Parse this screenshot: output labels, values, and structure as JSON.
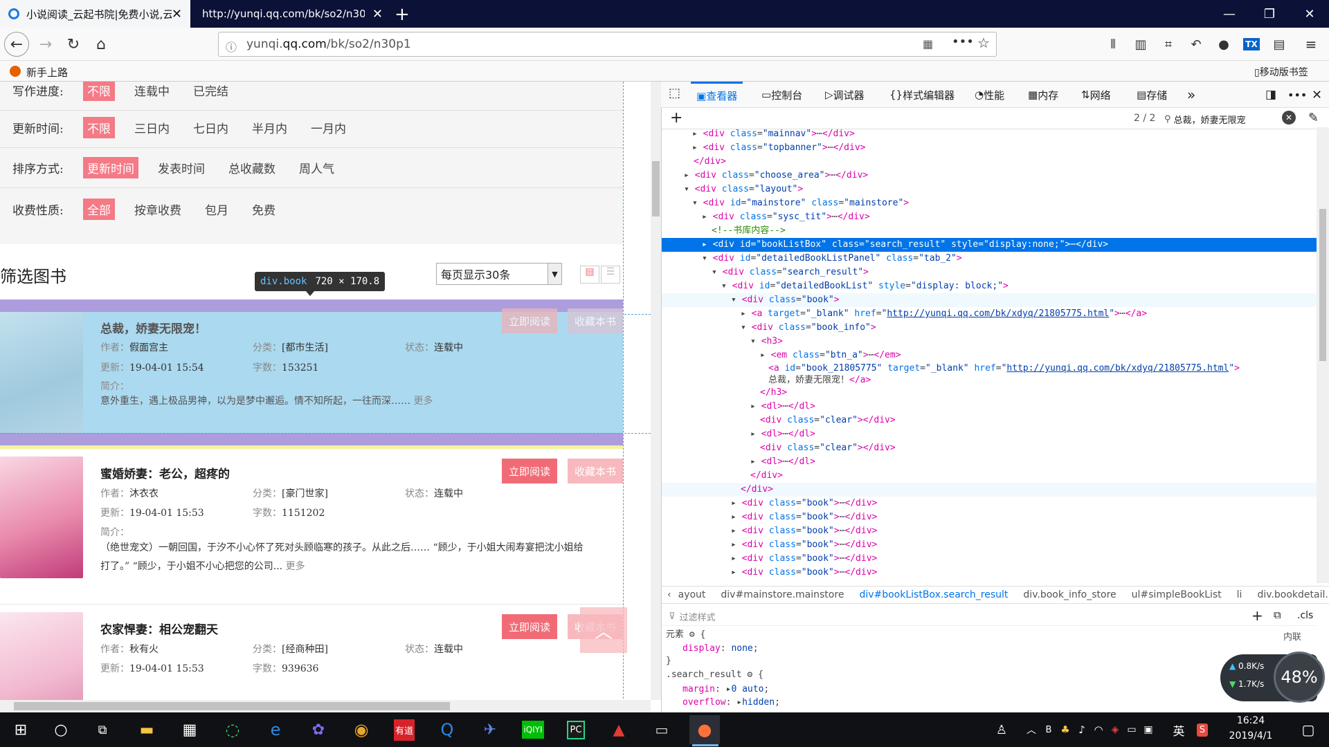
{
  "browser": {
    "tabs": [
      {
        "title": "小说阅读_云起书院|免费小说,云"
      },
      {
        "title": "http://yunqi.qq.com/bk/so2/n30"
      }
    ],
    "url_prefix": "yunqi.",
    "url_domain": "qq.com",
    "url_path": "/bk/so2/n30p1",
    "bookmark": "新手上路",
    "mobile_bookmark": "移动版书签"
  },
  "page": {
    "filters": [
      {
        "label": "写作进度:",
        "options": [
          "不限",
          "连载中",
          "已完结"
        ],
        "selected": 0
      },
      {
        "label": "更新时间:",
        "options": [
          "不限",
          "三日内",
          "七日内",
          "半月内",
          "一月内"
        ],
        "selected": 0
      },
      {
        "label": "排序方式:",
        "options": [
          "更新时间",
          "发表时间",
          "总收藏数",
          "周人气"
        ],
        "selected": 0
      },
      {
        "label": "收费性质:",
        "options": [
          "全部",
          "按章收费",
          "包月",
          "免费"
        ],
        "selected": 0
      }
    ],
    "section_title": "筛选图书",
    "per_page": "每页显示30条",
    "tooltip_tag": "div.book",
    "tooltip_size": "720 × 170.8",
    "read_label": "立即阅读",
    "fav_label": "收藏本书",
    "more_label": "更多",
    "intro_label": "简介：",
    "books": [
      {
        "title": "总裁，娇妻无限宠！",
        "author_label": "作者：",
        "author": "假面宫主",
        "category_label": "分类：",
        "category": "[都市生活]",
        "status_label": "状态：",
        "status": "连载中",
        "updated_label": "更新：",
        "updated": "19-04-01 15:54",
        "words_label": "字数：",
        "words": "153251",
        "intro": "意外重生，遇上极品男神，以为是梦中邂逅。情不知所起，一往而深……"
      },
      {
        "title": "蜜婚娇妻：老公，超疼的",
        "author_label": "作者：",
        "author": "沐衣衣",
        "category_label": "分类：",
        "category": "[豪门世家]",
        "status_label": "状态：",
        "status": "连载中",
        "updated_label": "更新：",
        "updated": "19-04-01 15:53",
        "words_label": "字数：",
        "words": "1151202",
        "intro": "（绝世宠文）一朝回国，于汐不小心怀了死对头顾临寒的孩子。从此之后……  “顾少，于小姐大闹寿宴把沈小姐给打了。” “顾少，于小姐不小心把您的公司..."
      },
      {
        "title": "农家悍妻：相公宠翻天",
        "author_label": "作者：",
        "author": "秋有火",
        "category_label": "分类：",
        "category": "[经商种田]",
        "status_label": "状态：",
        "status": "连载中",
        "updated_label": "更新：",
        "updated": "19-04-01 15:53",
        "words_label": "字数：",
        "words": "939636",
        "intro": ""
      }
    ]
  },
  "devtools": {
    "tabs": [
      "查看器",
      "控制台",
      "调试器",
      "样式编辑器",
      "性能",
      "内存",
      "网络",
      "存储"
    ],
    "search_count": "2 / 2",
    "search_query": "总裁，娇妻无限宠",
    "breadcrumbs": [
      "ayout",
      "div#mainstore.mainstore",
      "div#bookListBox.search_result",
      "div.book_info_store",
      "ul#simpleBookList",
      "li",
      "div.bookdetail.bg"
    ],
    "filter_placeholder": "过滤样式",
    "layout_label": "内联",
    "cls_label": ".cls",
    "rules": [
      {
        "selector": "元素",
        "props": [
          [
            "display",
            "none"
          ]
        ]
      },
      {
        "selector": ".search_result",
        "props": [
          [
            "margin",
            "0 auto"
          ],
          [
            "overflow",
            "hidden"
          ]
        ]
      }
    ],
    "net_up": "0.8K/s",
    "net_down": "1.7K/s",
    "cpu": "48%"
  },
  "taskbar": {
    "time": "16:24",
    "date": "2019/4/1",
    "ime": "英"
  }
}
